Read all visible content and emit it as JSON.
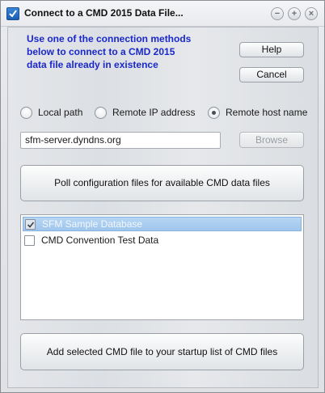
{
  "window": {
    "title": "Connect to a CMD 2015 Data File...",
    "controls": {
      "minimize": "−",
      "maximize": "+",
      "close": "×"
    }
  },
  "instructions": "Use one of the connection methods below to connect to a CMD 2015 data file already in existence",
  "buttons": {
    "help": "Help",
    "cancel": "Cancel",
    "browse": "Browse",
    "poll": "Poll configuration files for available CMD data files",
    "add": "Add selected CMD file to your startup list of CMD files"
  },
  "connection": {
    "options": [
      "Local path",
      "Remote IP address",
      "Remote host name"
    ],
    "selected": "Remote host name",
    "host_value": "sfm-server.dyndns.org"
  },
  "data_files": [
    {
      "label": "SFM Sample Database",
      "checked": true,
      "selected": true
    },
    {
      "label": "CMD Convention Test Data",
      "checked": false,
      "selected": false
    }
  ],
  "colors": {
    "instruction_text": "#1a28c9",
    "selection": "#a9cdee",
    "disabled_text": "#9a9ea4"
  }
}
